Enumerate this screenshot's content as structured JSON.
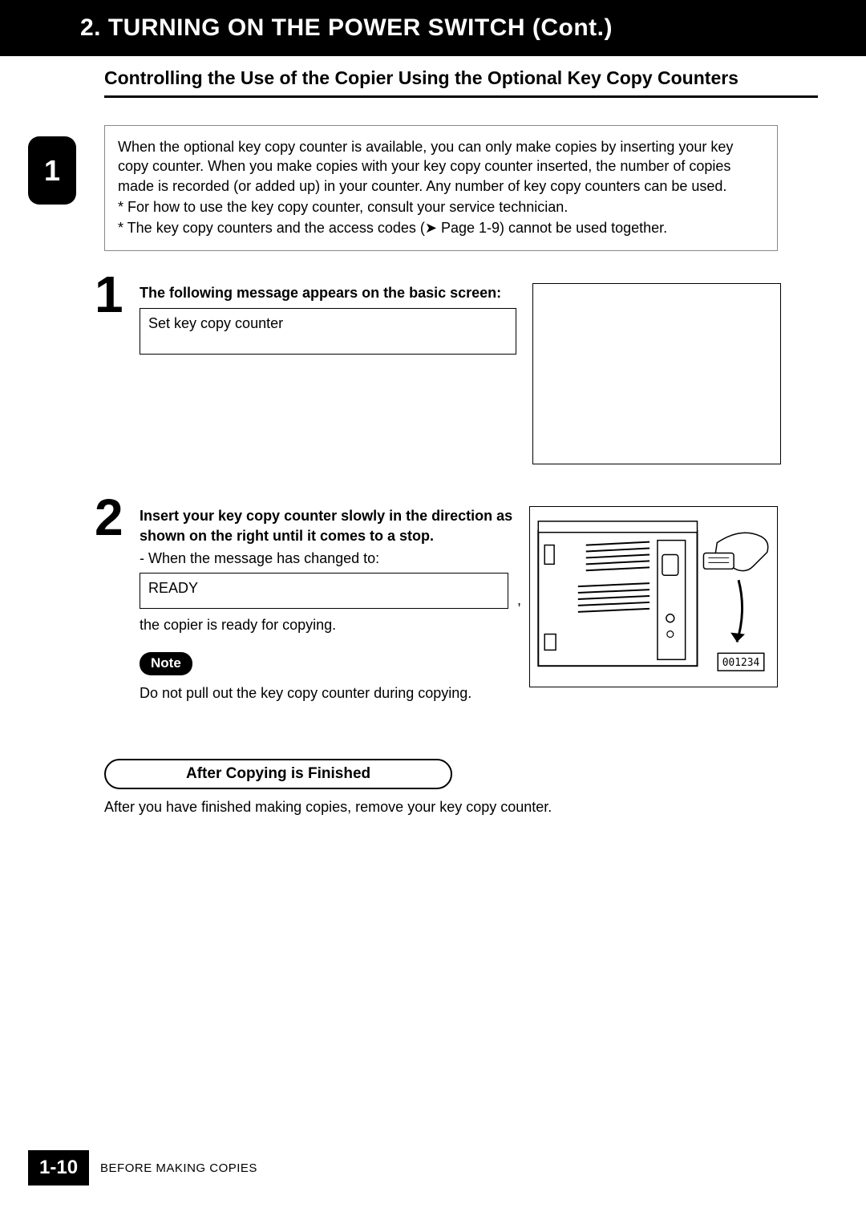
{
  "header": {
    "title": "2. TURNING ON THE POWER SWITCH (Cont.)",
    "subtitle": "Controlling the Use of the Copier Using the Optional Key Copy Counters"
  },
  "chapter_tab": "1",
  "info_box": {
    "main": "When the optional key copy counter is available, you can only make copies by inserting your key copy counter. When you make copies with your key copy counter inserted, the number of copies made is recorded (or added up) in your counter. Any number of key copy counters can be used.",
    "bullet1": "* For how to use the key copy counter, consult your service technician.",
    "bullet2": "* The key copy counters and the access codes (➤ Page 1-9) cannot be used together."
  },
  "step1": {
    "num": "1",
    "heading": "The following message appears on the basic screen:",
    "message": "Set key copy counter"
  },
  "step2": {
    "num": "2",
    "heading": "Insert your key copy counter slowly in the direction as shown on the right until it comes to a stop.",
    "line1": "- When the message has changed to:",
    "message": "READY",
    "tail_comma": ",",
    "line2": "the copier is ready for copying.",
    "note_label": "Note",
    "note_text": "Do not pull out the key copy counter during copying."
  },
  "after": {
    "title": "After Copying is Finished",
    "text": "After you have finished making copies, remove your key copy counter."
  },
  "illustration": {
    "counter_reading": "001234"
  },
  "footer": {
    "page": "1-10",
    "section": "BEFORE MAKING COPIES"
  }
}
